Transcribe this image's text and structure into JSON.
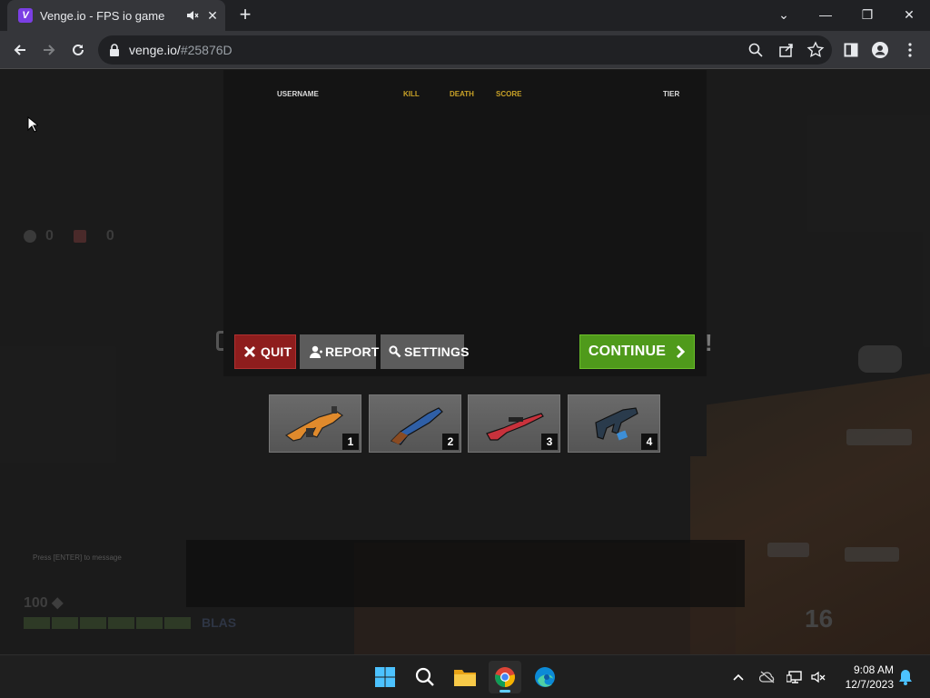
{
  "browser": {
    "tab_title": "Venge.io - FPS io game",
    "favicon_letter": "V",
    "url_host": "venge.io/",
    "url_path": "#25876D",
    "accent": "#7b3fe4"
  },
  "game": {
    "scoreboard": {
      "headers": {
        "username": "USERNAME",
        "kill": "KILL",
        "death": "DEATH",
        "score": "SCORE",
        "tier": "TIER"
      },
      "rows": []
    },
    "buttons": {
      "quit": "QUIT",
      "report": "REPORT",
      "settings": "SETTINGS",
      "continue": "CONTINUE"
    },
    "loadout": [
      {
        "slot": "1",
        "weapon": "orange-assault-rifle-icon",
        "color": "#e08a2c"
      },
      {
        "slot": "2",
        "weapon": "blue-shotgun-icon",
        "color": "#2f5fa6"
      },
      {
        "slot": "3",
        "weapon": "red-sniper-rifle-icon",
        "color": "#c8323c"
      },
      {
        "slot": "4",
        "weapon": "blue-smg-icon",
        "color": "#3d8fd8"
      }
    ],
    "hud": {
      "team_score_left": "0",
      "team_score_right": "0",
      "chat_hint": "Press [ENTER] to message",
      "health": "100",
      "ammo_tag": "BLAS",
      "right_number": "16"
    },
    "colors": {
      "quit": "#8e1d1d",
      "continue": "#4f9a1b",
      "header_gold": "#c9a227"
    }
  },
  "taskbar": {
    "time": "9:08 AM",
    "date": "12/7/2023",
    "apps": [
      "windows-start",
      "search",
      "file-explorer",
      "chrome",
      "edge"
    ]
  }
}
